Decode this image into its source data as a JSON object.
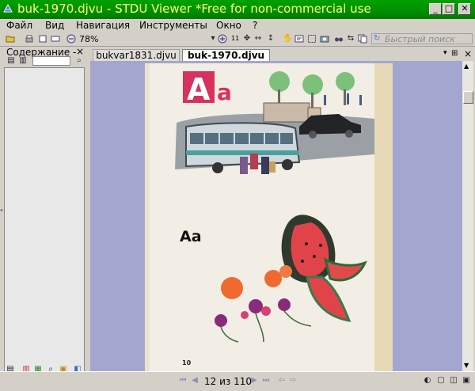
{
  "window": {
    "title": "buk-1970.djvu - STDU Viewer *Free for non-commercial use"
  },
  "menu": [
    "Файл",
    "Вид",
    "Навигация",
    "Инструменты",
    "Окно",
    "?"
  ],
  "toolbar": {
    "zoom": "78%",
    "search_placeholder": "Быстрый поиск",
    "size_label": "11"
  },
  "sidebar": {
    "title": "Содержание -",
    "close": "×"
  },
  "tabs": [
    {
      "label": "bukvar1831.djvu",
      "active": false
    },
    {
      "label": "buk-1970.djvu",
      "active": true
    }
  ],
  "page": {
    "big_letter": "A",
    "big_letter_lower": "a",
    "text_letters": "Aa",
    "page_number": "10"
  },
  "navigation": {
    "page_indicator": "12 из 110"
  },
  "colors": {
    "titlebar": "#008f00",
    "title_text": "#ffff80",
    "doc_background": "#a3a6ce",
    "letter_box": "#d8315e"
  }
}
